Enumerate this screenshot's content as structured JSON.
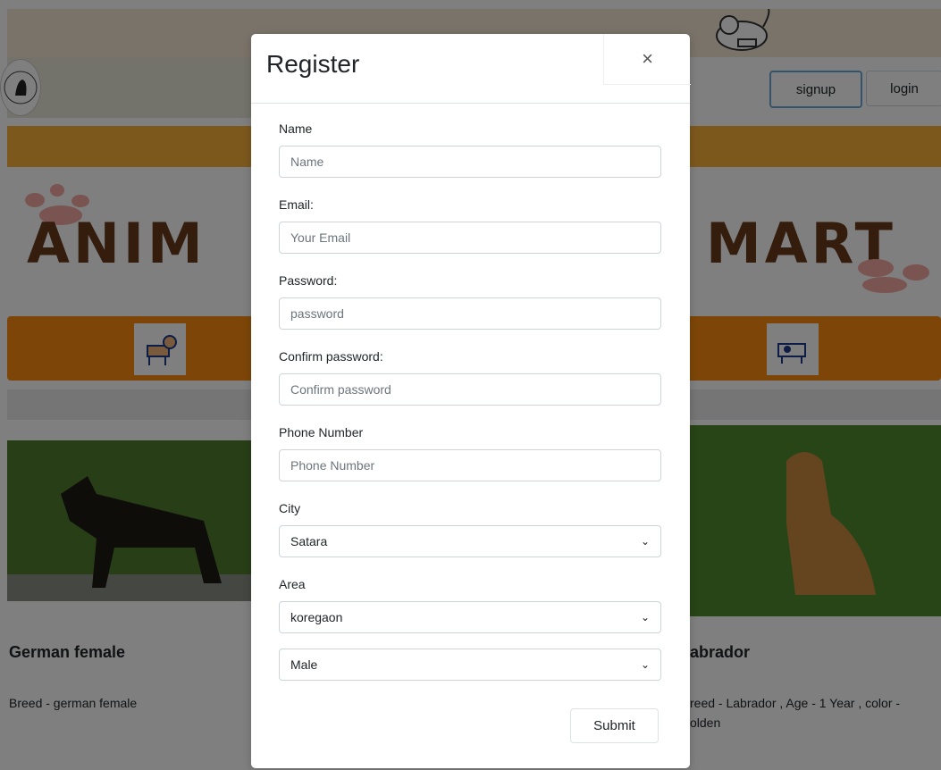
{
  "navbar": {
    "signup_label": "signup",
    "login_label": "login"
  },
  "banner": {
    "left_text": "ANIM",
    "right_text": "MART"
  },
  "cards": [
    {
      "title": "German female",
      "text": "Breed - german female"
    },
    {
      "title": "abrador",
      "text_line1": "reed - Labrador , Age - 1 Year , color -",
      "text_line2": "olden"
    }
  ],
  "modal": {
    "title": "Register",
    "close_label": "×",
    "fields": {
      "name": {
        "label": "Name",
        "placeholder": "Name"
      },
      "email": {
        "label": "Email:",
        "placeholder": "Your Email"
      },
      "password": {
        "label": "Password:",
        "placeholder": "password"
      },
      "confirm": {
        "label": "Confirm password:",
        "placeholder": "Confirm password"
      },
      "phone": {
        "label": "Phone Number",
        "placeholder": "Phone Number"
      },
      "city": {
        "label": "City",
        "value": "Satara"
      },
      "area": {
        "label": "Area",
        "value": "koregaon"
      },
      "gender": {
        "value": "Male"
      }
    },
    "submit_label": "Submit"
  },
  "colors": {
    "orange": "#fb8c10",
    "light_orange": "#fbb03b",
    "banner_brown": "#6a3b1a"
  }
}
